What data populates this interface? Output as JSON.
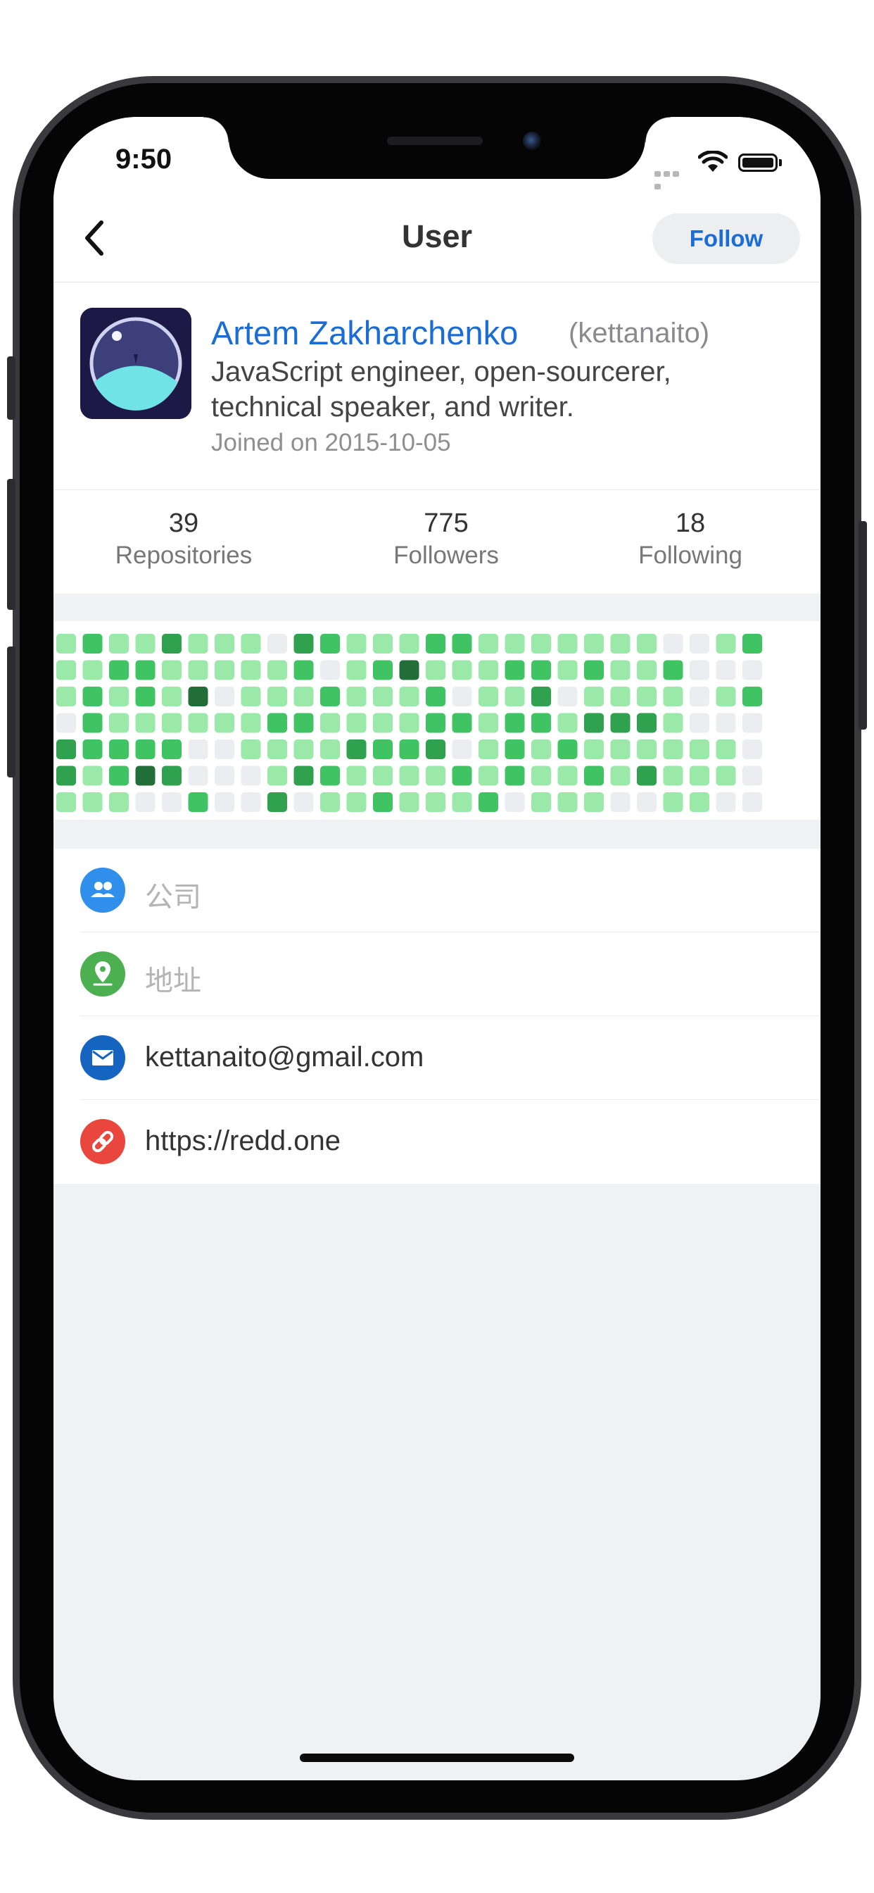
{
  "status_bar": {
    "time": "9:50"
  },
  "nav": {
    "title": "User",
    "follow_label": "Follow",
    "back_icon": "chevron-left-icon"
  },
  "profile": {
    "name": "Artem Zakharchenko",
    "login": "(kettanaito)",
    "bio": "JavaScript engineer, open-sourcerer, technical speaker, and writer.",
    "joined": "Joined on 2015-10-05"
  },
  "stats": [
    {
      "value": "39",
      "label": "Repositories"
    },
    {
      "value": "775",
      "label": "Followers"
    },
    {
      "value": "18",
      "label": "Following"
    }
  ],
  "contributions": {
    "colors": [
      "#ebedf0",
      "#9be9a8",
      "#40c463",
      "#30a14e",
      "#216e39"
    ],
    "weeks": [
      [
        1,
        1,
        1,
        0,
        3,
        3,
        1
      ],
      [
        2,
        1,
        2,
        2,
        2,
        1,
        1
      ],
      [
        1,
        2,
        1,
        1,
        2,
        2,
        1
      ],
      [
        1,
        2,
        2,
        1,
        2,
        4,
        0
      ],
      [
        3,
        1,
        1,
        1,
        2,
        3,
        0
      ],
      [
        1,
        1,
        4,
        1,
        0,
        0,
        2
      ],
      [
        1,
        1,
        0,
        1,
        0,
        0,
        0
      ],
      [
        1,
        1,
        1,
        1,
        1,
        0,
        0
      ],
      [
        0,
        1,
        1,
        2,
        1,
        1,
        3
      ],
      [
        3,
        2,
        1,
        2,
        1,
        3,
        0
      ],
      [
        2,
        0,
        2,
        1,
        1,
        2,
        1
      ],
      [
        1,
        1,
        1,
        1,
        3,
        1,
        1
      ],
      [
        1,
        2,
        1,
        1,
        2,
        1,
        2
      ],
      [
        1,
        4,
        1,
        1,
        2,
        1,
        1
      ],
      [
        2,
        1,
        2,
        2,
        3,
        1,
        1
      ],
      [
        2,
        1,
        0,
        2,
        0,
        2,
        1
      ],
      [
        1,
        1,
        1,
        1,
        1,
        1,
        2
      ],
      [
        1,
        2,
        1,
        2,
        2,
        2,
        0
      ],
      [
        1,
        2,
        3,
        2,
        1,
        1,
        1
      ],
      [
        1,
        1,
        0,
        1,
        2,
        1,
        1
      ],
      [
        1,
        2,
        1,
        3,
        1,
        2,
        1
      ],
      [
        1,
        1,
        1,
        3,
        1,
        1,
        0
      ],
      [
        1,
        1,
        1,
        3,
        1,
        3,
        0
      ],
      [
        0,
        2,
        1,
        1,
        1,
        1,
        1
      ],
      [
        0,
        0,
        0,
        0,
        1,
        1,
        1
      ],
      [
        1,
        0,
        1,
        0,
        1,
        1,
        0
      ],
      [
        2,
        0,
        2,
        0,
        0,
        0,
        0
      ]
    ]
  },
  "info": [
    {
      "text": "公司",
      "muted": true,
      "icon": "company-icon",
      "color": "#2f8fea"
    },
    {
      "text": "地址",
      "muted": true,
      "icon": "location-icon",
      "color": "#4caf50"
    },
    {
      "text": "kettanaito@gmail.com",
      "muted": false,
      "icon": "email-icon",
      "color": "#1565c0"
    },
    {
      "text": "https://redd.one",
      "muted": false,
      "icon": "link-icon",
      "color": "#e9463d"
    }
  ]
}
